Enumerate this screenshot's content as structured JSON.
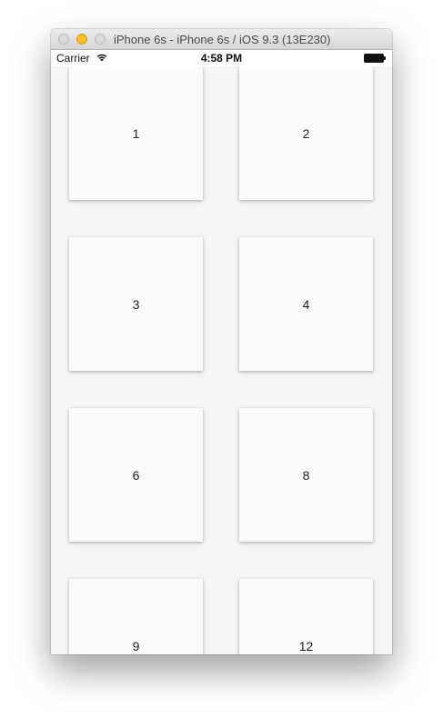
{
  "window": {
    "title": "iPhone 6s - iPhone 6s / iOS 9.3 (13E230)"
  },
  "status_bar": {
    "carrier": "Carrier",
    "time": "4:58 PM",
    "icons": [
      "wifi-icon",
      "battery-icon"
    ]
  },
  "grid": {
    "tiles": [
      {
        "label": "1"
      },
      {
        "label": "2"
      },
      {
        "label": "3"
      },
      {
        "label": "4"
      },
      {
        "label": "6"
      },
      {
        "label": "8"
      },
      {
        "label": "9"
      },
      {
        "label": "12"
      }
    ]
  },
  "colors": {
    "traffic_close": "#d9d9d9",
    "traffic_minimize": "#f5bf2e",
    "traffic_zoom": "#d9d9d9",
    "tile_background": "#fafafa",
    "screen_background": "#f5f5f5"
  }
}
